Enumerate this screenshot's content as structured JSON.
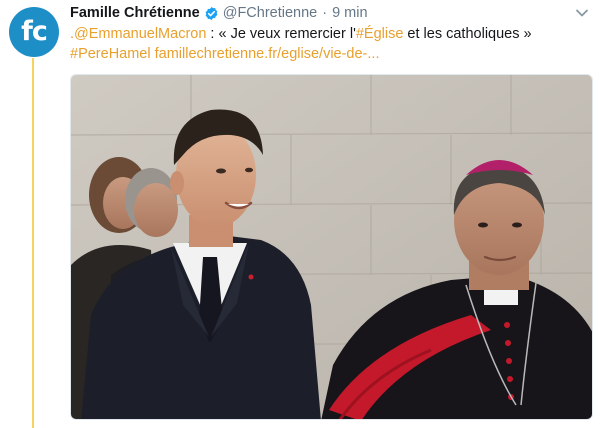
{
  "account": {
    "avatar_initials": "fc",
    "display_name": "Famille Chrétienne",
    "handle": "@FChretienne",
    "separator": "·",
    "timestamp": "9 min",
    "verified": true
  },
  "tweet": {
    "mention": ".@EmmanuelMacron",
    "text_part1": " : « Je veux remercier l'",
    "hashtag_eglise": "#Église",
    "text_part2": " et les catholiques »",
    "hashtag_perehamel": "#PereHamel",
    "url": "famillechretienne.fr/eglise/vie-de-..."
  },
  "media": {
    "icon": "photo"
  },
  "colors": {
    "brand_blue": "#1d8ec6",
    "link_accent": "#e8a02d",
    "thread_line": "#f4d35e",
    "muted_text": "#657786",
    "verified_blue": "#1da1f2"
  },
  "icons": {
    "verified": "verified-badge-icon",
    "menu": "chevron-down-icon"
  }
}
